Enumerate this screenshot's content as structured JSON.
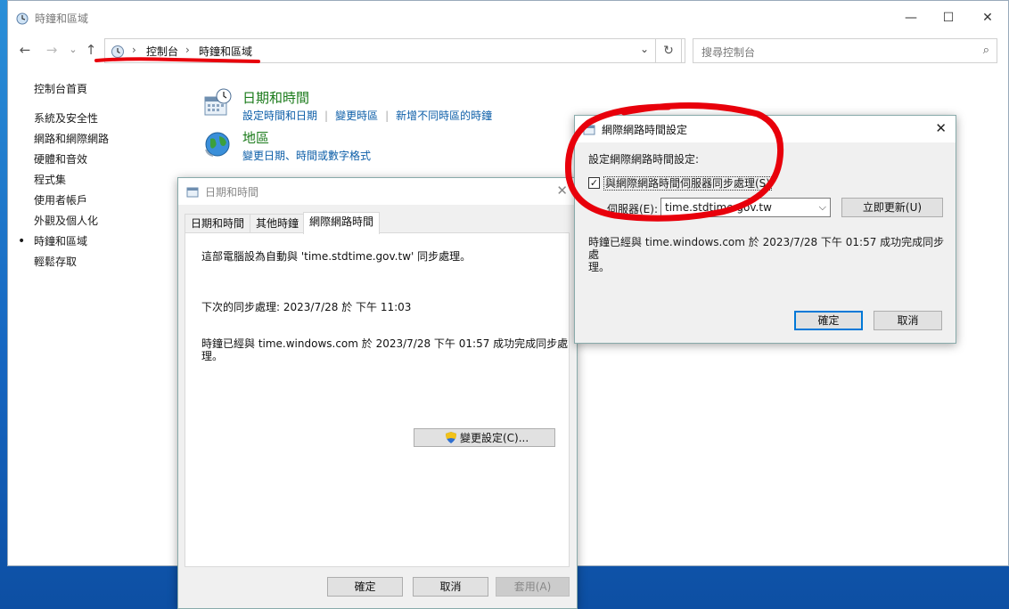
{
  "window": {
    "title": "時鐘和區域",
    "controls": {
      "minimize": "—",
      "maximize": "☐",
      "close": "✕"
    }
  },
  "nav": {
    "back": "←",
    "forward": "→",
    "recent": "⌄",
    "up": "↑"
  },
  "breadcrumb": {
    "items": [
      "控制台",
      "時鐘和區域"
    ],
    "separator": "›"
  },
  "search": {
    "placeholder": "搜尋控制台"
  },
  "sidebar": {
    "home": "控制台首頁",
    "items": [
      "系統及安全性",
      "網路和網際網路",
      "硬體和音效",
      "程式集",
      "使用者帳戶",
      "外觀及個人化",
      "時鐘和區域",
      "輕鬆存取"
    ],
    "active_index": 6
  },
  "categories": [
    {
      "title": "日期和時間",
      "links": [
        "設定時間和日期",
        "變更時區",
        "新增不同時區的時鐘"
      ],
      "icon": "calendar-icon"
    },
    {
      "title": "地區",
      "links": [
        "變更日期、時間或數字格式"
      ],
      "icon": "globe-icon"
    }
  ],
  "dt_dialog": {
    "title": "日期和時間",
    "tabs": [
      "日期和時間",
      "其他時鐘",
      "網際網路時間"
    ],
    "active_tab": 2,
    "line1": "這部電腦設為自動與 'time.stdtime.gov.tw' 同步處理。",
    "line2": "下次的同步處理: 2023/7/28 於 下午 11:03",
    "line3a": "時鐘已經與 time.windows.com 於 2023/7/28 下午 01:57 成功完成同步處",
    "line3b": "理。",
    "change_button": "變更設定(C)...",
    "ok": "確定",
    "cancel": "取消",
    "apply": "套用(A)"
  },
  "inet_dialog": {
    "title": "網際網路時間設定",
    "heading": "設定網際網路時間設定:",
    "sync_checkbox": "與網際網路時間伺服器同步處理(S)",
    "sync_checked": true,
    "server_label": "伺服器(E):",
    "server_value": "time.stdtime.gov.tw",
    "update_button": "立即更新(U)",
    "status_a": "時鐘已經與 time.windows.com 於 2023/7/28 下午 01:57 成功完成同步處",
    "status_b": "理。",
    "ok": "確定",
    "cancel": "取消"
  },
  "colors": {
    "annotation_red": "#e8000b",
    "link_blue": "#0c5ea8",
    "category_green": "#1a7a1a",
    "focus_blue": "#0078d7"
  }
}
